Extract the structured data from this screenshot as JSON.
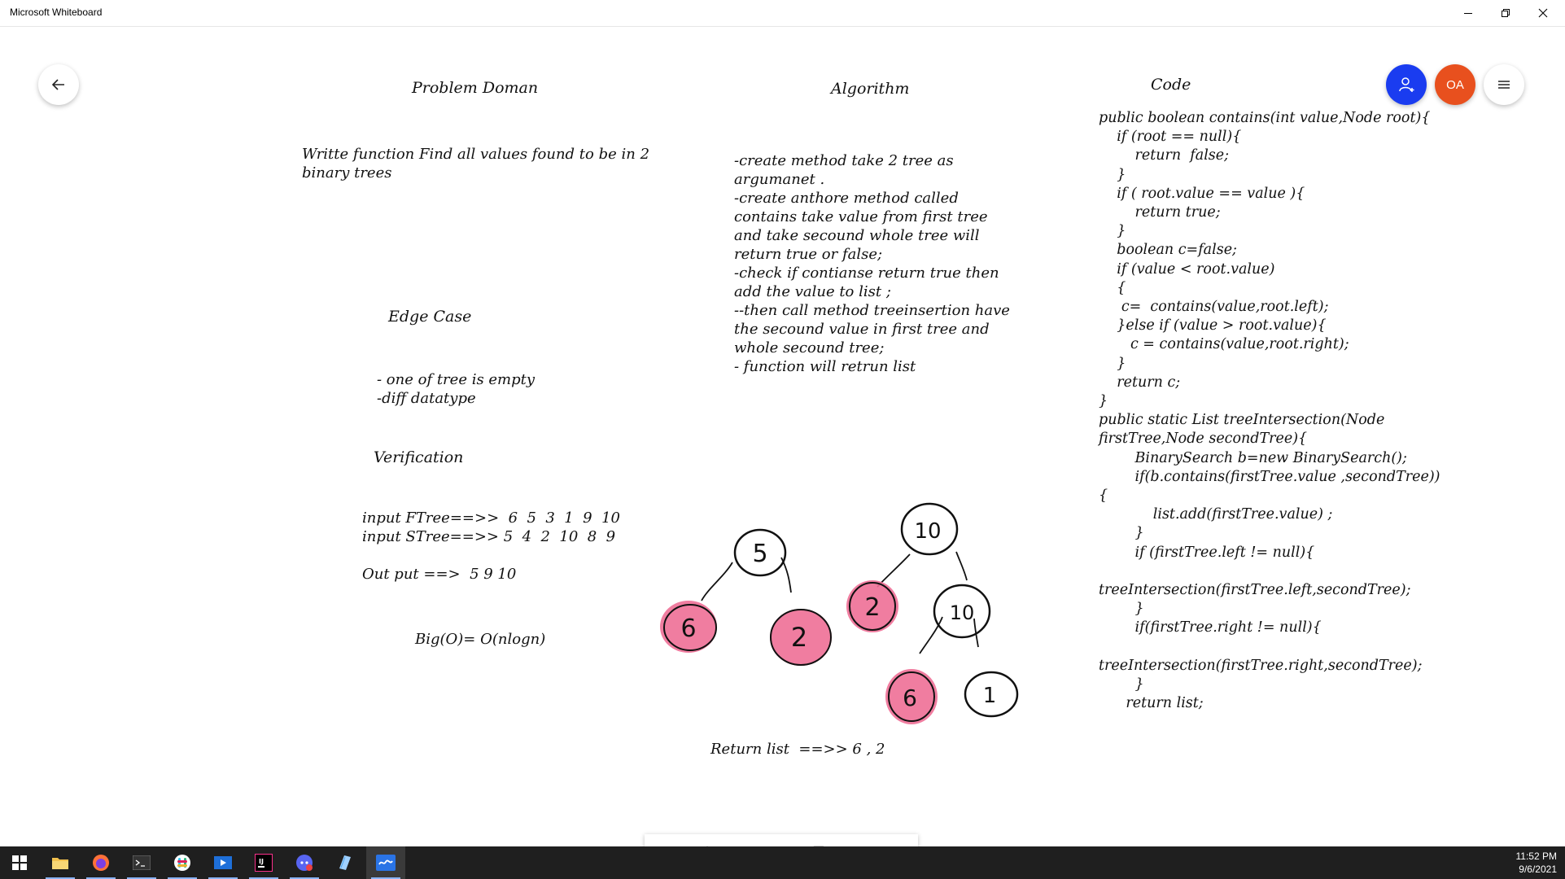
{
  "window": {
    "title": "Microsoft Whiteboard"
  },
  "header": {
    "avatar_initials": "OA"
  },
  "colors": {
    "invite_blue": "#1a3cf0",
    "avatar_orange": "#e8501e",
    "highlight_pink": "#ee6f96"
  },
  "board": {
    "problem_domain": {
      "heading": "Problem Doman",
      "text": "Writte function Find all values found to be in 2\nbinary trees"
    },
    "edge_case": {
      "heading": "Edge Case",
      "text": "- one of tree is empty\n-diff datatype"
    },
    "verification": {
      "heading": "Verification",
      "text": "input FTree==>>  6  5  3  1  9  10\ninput STree==>> 5  4  2  10  8  9\n\nOut put ==>  5 9 10"
    },
    "big_o": "Big(O)= O(nlogn)",
    "algorithm": {
      "heading": "Algorithm",
      "text": "-create method take 2 tree as\nargumanet .\n-create anthore method called\ncontains take value from first tree\nand take secound whole tree will\nreturn true or false;\n-check if contianse return true then\nadd the value to list ;\n--then call method treeinsertion have\nthe secound value in first tree and\nwhole secound tree;\n- function will retrun list"
    },
    "code": {
      "heading": "Code",
      "text": "public boolean contains(int value,Node root){\n    if (root == null){\n        return  false;\n    }\n    if ( root.value == value ){\n        return true;\n    }\n    boolean c=false;\n    if (value < root.value)\n    {\n     c=  contains(value,root.left);\n    }else if (value > root.value){\n       c = contains(value,root.right);\n    }\n    return c;\n}\npublic static List treeIntersection(Node\nfirstTree,Node secondTree){\n        BinarySearch b=new BinarySearch();\n        if(b.contains(firstTree.value ,secondTree))\n{\n            list.add(firstTree.value) ;\n        }\n        if (firstTree.left != null){\n\ntreeIntersection(firstTree.left,secondTree);\n        }\n        if(firstTree.right != null){\n\ntreeIntersection(firstTree.right,secondTree);\n        }\n      return list;"
    },
    "return_list": "Return list  ==>> 6 , 2",
    "tree1": {
      "root": "5",
      "left": "6",
      "right": "2"
    },
    "tree2": {
      "root": "10",
      "left": "2",
      "right": "10",
      "right_left": "6",
      "right_right": "1"
    }
  },
  "toolbar": {
    "tools": [
      "pen-icon",
      "text-icon",
      "note-icon",
      "image-icon",
      "insert-icon",
      "undo-icon",
      "redo-icon"
    ]
  },
  "taskbar": {
    "time": "11:52 PM",
    "date": "9/6/2021"
  }
}
